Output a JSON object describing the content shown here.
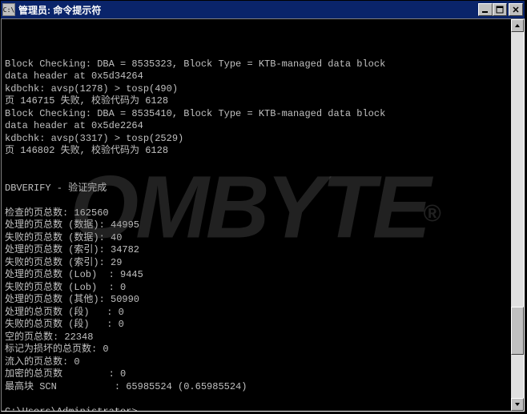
{
  "window": {
    "sysicon_label": "C:\\",
    "title": "管理员: 命令提示符"
  },
  "terminal": {
    "lines": [
      "Block Checking: DBA = 8535323, Block Type = KTB-managed data block",
      "data header at 0x5d34264",
      "kdbchk: avsp(1278) > tosp(490)",
      "页 146715 失败, 校验代码为 6128",
      "Block Checking: DBA = 8535410, Block Type = KTB-managed data block",
      "data header at 0x5de2264",
      "kdbchk: avsp(3317) > tosp(2529)",
      "页 146802 失败, 校验代码为 6128",
      "",
      "",
      "DBVERIFY - 验证完成",
      "",
      "检查的页总数: 162560",
      "处理的页总数 (数据): 44995",
      "失败的页总数 (数据): 40",
      "处理的页总数 (索引): 34782",
      "失败的页总数 (索引): 29",
      "处理的页总数 (Lob)  : 9445",
      "失败的页总数 (Lob)  : 0",
      "处理的页总数 (其他): 50990",
      "处理的总页数 (段)   : 0",
      "失败的总页数 (段)   : 0",
      "空的页总数: 22348",
      "标记为损坏的总页数: 0",
      "流入的页总数: 0",
      "加密的总页数        : 0",
      "最高块 SCN          : 65985524 (0.65985524)",
      "",
      "C:\\Users\\Administrator>"
    ]
  },
  "watermark": {
    "text": "OMBYTE",
    "reg": "®"
  }
}
